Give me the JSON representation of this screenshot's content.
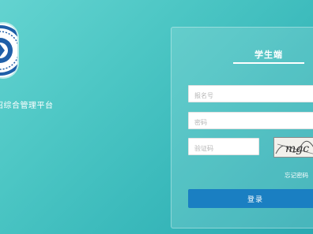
{
  "platform": {
    "title": "招综合管理平台"
  },
  "login": {
    "panel_title": "学生端",
    "username": {
      "placeholder": "报名号",
      "value": ""
    },
    "password": {
      "placeholder": "密码",
      "value": ""
    },
    "captcha_input": {
      "placeholder": "验证码",
      "value": ""
    },
    "captcha_image_text": "mgc",
    "forgot_password_label": "忘记密码",
    "submit_label": "登录"
  },
  "colors": {
    "background": "#4cc6c4",
    "button": "#1a7fc2",
    "text_light": "#ffffff"
  }
}
